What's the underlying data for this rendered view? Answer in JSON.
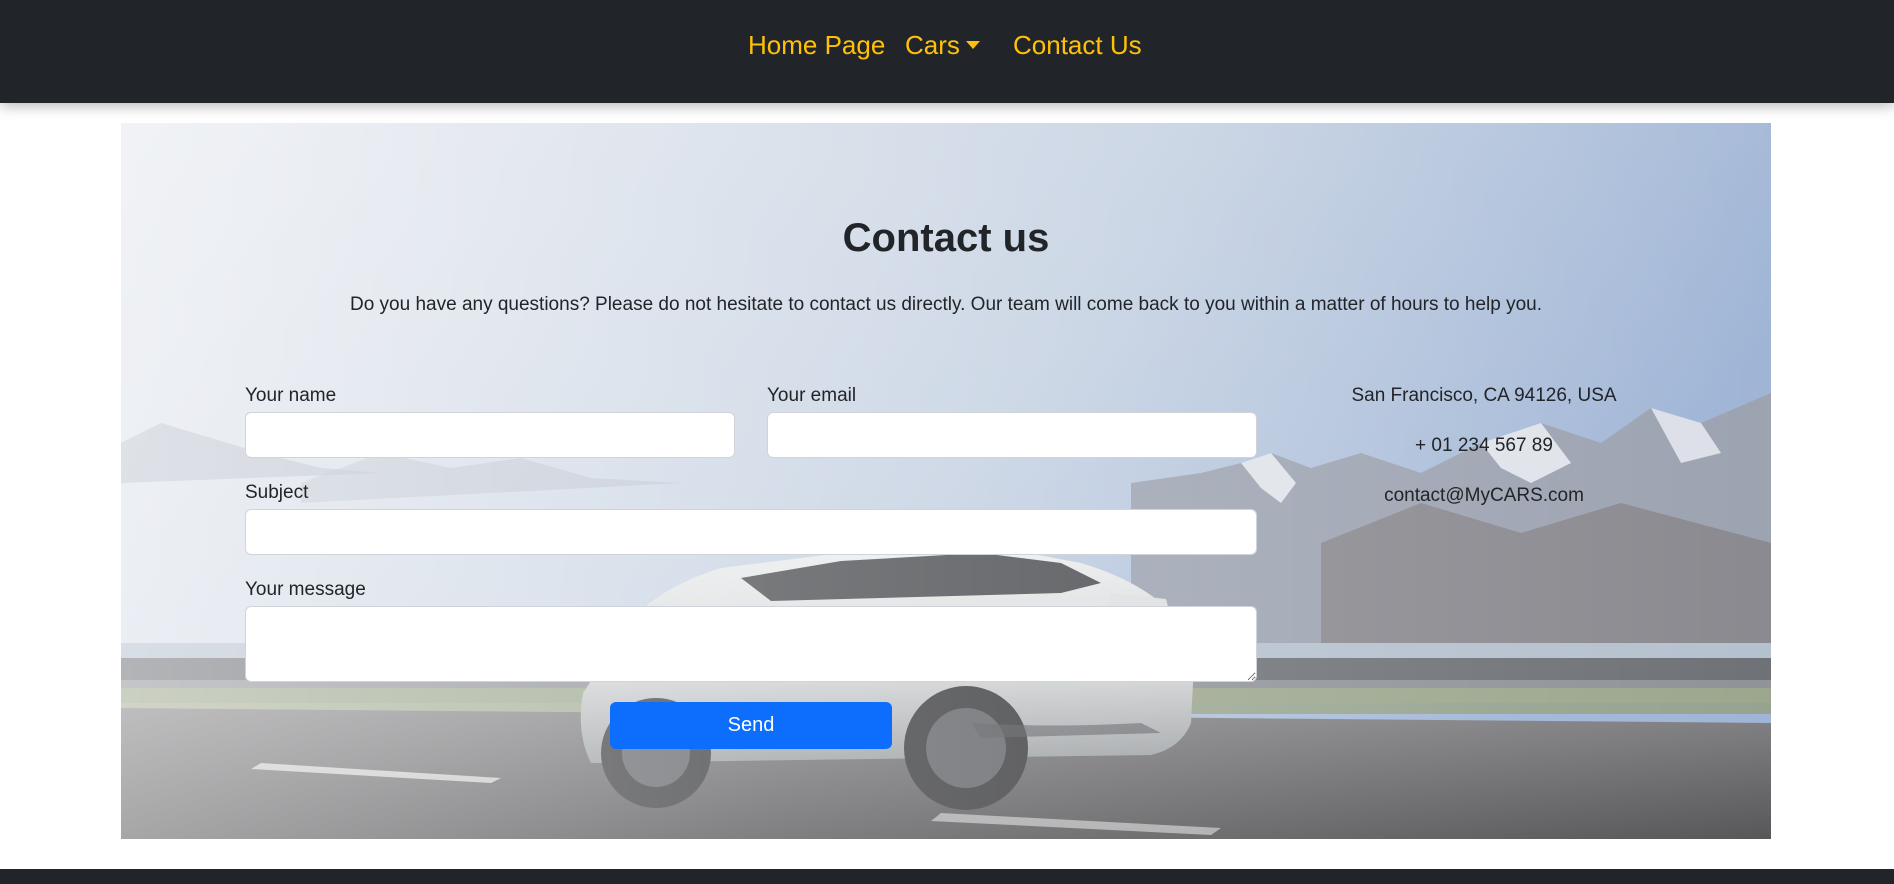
{
  "nav": {
    "home_label": "Home Page",
    "cars_label": "Cars",
    "contact_label": "Contact Us",
    "accent_color": "#ffc107",
    "background_color": "#212529"
  },
  "contact": {
    "title": "Contact us",
    "intro": "Do you have any questions? Please do not hesitate to contact us directly. Our team will come back to you within a matter of hours to help you.",
    "form": {
      "name_label": "Your name",
      "name_value": "",
      "email_label": "Your email",
      "email_value": "",
      "subject_label": "Subject",
      "subject_value": "",
      "message_label": "Your message",
      "message_value": "",
      "send_label": "Send",
      "send_color": "#0d6efd"
    },
    "info": {
      "address": "San Francisco, CA 94126, USA",
      "phone": "+ 01 234 567 89",
      "email": "contact@MyCARS.com"
    }
  }
}
